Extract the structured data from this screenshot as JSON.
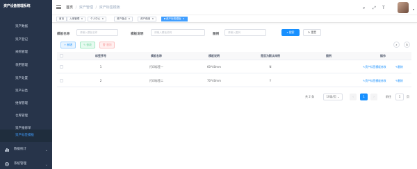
{
  "app": {
    "title": "资产设备管理系统"
  },
  "sidebar": {
    "items": [
      {
        "label": "资产数据"
      },
      {
        "label": "资产登记"
      },
      {
        "label": "采购管理"
      },
      {
        "label": "领用管理"
      },
      {
        "label": "资产处置"
      },
      {
        "label": "资产分类"
      },
      {
        "label": "维保管理"
      },
      {
        "label": "仓库管理"
      },
      {
        "label": "资产报修单"
      },
      {
        "label": "资产标签模板"
      }
    ],
    "groups": [
      {
        "label": "数据统计"
      },
      {
        "label": "系统管理"
      }
    ]
  },
  "breadcrumb": {
    "home": "首页",
    "level1": "资产管理",
    "level2": "资产标签模板"
  },
  "tags": [
    {
      "label": "首页"
    },
    {
      "label": "入库管理"
    },
    {
      "label": "个人中心"
    },
    {
      "label": "资产盘点"
    },
    {
      "label": "资产借用"
    },
    {
      "label": "资产标签模板"
    }
  ],
  "search": {
    "name_label": "模板名称",
    "name_placeholder": "请输入模板名称",
    "desc_label": "模板说明",
    "desc_placeholder": "请输入模板说明",
    "image_label": "图例",
    "image_placeholder": "请输入图例",
    "search_btn": "搜索",
    "reset_btn": "重置"
  },
  "toolbar": {
    "add": "新增",
    "edit": "修改",
    "delete": "删除"
  },
  "table": {
    "columns": [
      "标签序号",
      "模板名称",
      "模板说明",
      "是否为默认样例",
      "图例",
      "操作"
    ],
    "rows": [
      {
        "no": "1",
        "name": "打印标签一",
        "size": "60*40mm",
        "default": "N",
        "image": ""
      },
      {
        "no": "2",
        "name": "打印标签二",
        "size": "70*40mm",
        "default": "Y",
        "image": ""
      }
    ],
    "actions": {
      "edit": "资产标签模板修改",
      "remove": "删除"
    }
  },
  "pagination": {
    "total": "共 2 条",
    "page_size": "10条/页",
    "current_page": "1",
    "goto_label": "前往",
    "goto_value": "1",
    "page_suffix": "页"
  }
}
